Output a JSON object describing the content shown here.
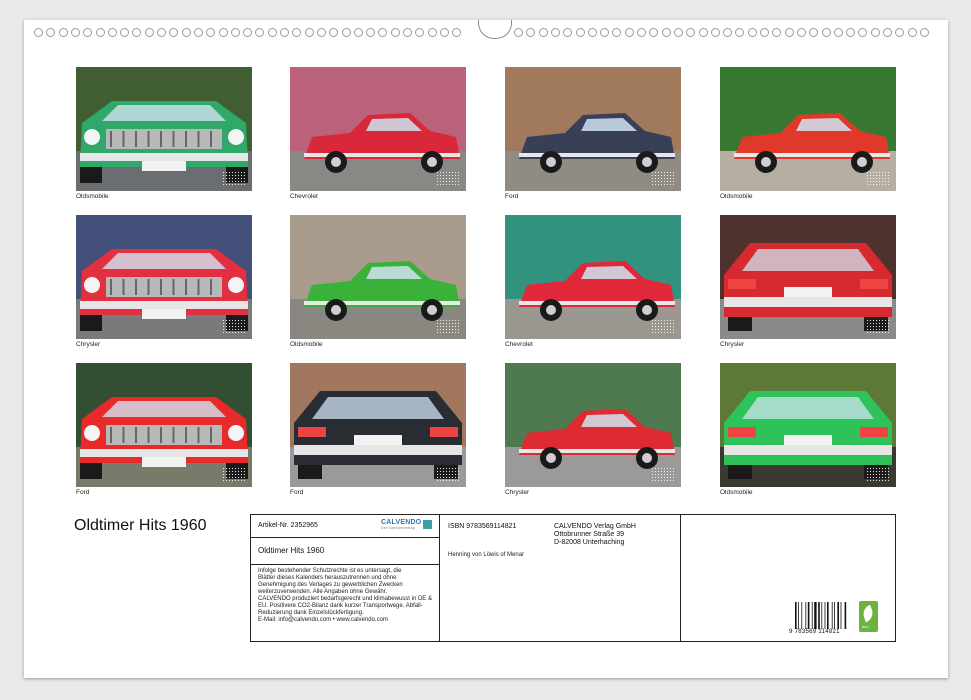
{
  "calendar": {
    "title": "Oldtimer Hits 1960",
    "photos": [
      {
        "caption": "Oldsmobile",
        "body": "#2fa86a",
        "bg": "#4a6a3a",
        "ground": "#6a6e70",
        "view": "front"
      },
      {
        "caption": "Chevrolet",
        "body": "#d8283a",
        "bg": "#d4708a",
        "ground": "#8a8884",
        "view": "side"
      },
      {
        "caption": "Ford",
        "body": "#3a3f58",
        "bg": "#b88a6a",
        "ground": "#908c84",
        "view": "side"
      },
      {
        "caption": "Oldsmobile",
        "body": "#e0382a",
        "bg": "#3f8a3a",
        "ground": "#b6aea2",
        "view": "side"
      },
      {
        "caption": "Chrysler",
        "body": "#e23040",
        "bg": "#4a5a8a",
        "ground": "#7a7a7a",
        "view": "front"
      },
      {
        "caption": "Oldsmobile",
        "body": "#3ab23a",
        "bg": "#c2b2a0",
        "ground": "#8a8680",
        "view": "side"
      },
      {
        "caption": "Chevrolet",
        "body": "#e0283a",
        "bg": "#38a890",
        "ground": "#9a9690",
        "view": "side"
      },
      {
        "caption": "Chrysler",
        "body": "#d62a30",
        "bg": "#5a3a34",
        "ground": "#8a8a8a",
        "view": "rear"
      },
      {
        "caption": "Ford",
        "body": "#e82a2a",
        "bg": "#3a5a3a",
        "ground": "#7a7a6a",
        "view": "front"
      },
      {
        "caption": "Ford",
        "body": "#2a2c34",
        "bg": "#b8886a",
        "ground": "#9a9a9a",
        "view": "rear"
      },
      {
        "caption": "Chrysler",
        "body": "#e02a32",
        "bg": "#5a8a5a",
        "ground": "#9a9a9a",
        "view": "side"
      },
      {
        "caption": "Oldsmobile",
        "body": "#2ec25a",
        "bg": "#6a8a40",
        "ground": "#3a3a30",
        "view": "rear"
      }
    ],
    "colors": {
      "border": "#222222",
      "accent": "#2a7ab8",
      "eco": "#6cb33e"
    }
  },
  "info": {
    "article": "Artikel-Nr. 2352965",
    "brand": "CALVENDO",
    "brand_sub": "Der Kalenderverlag",
    "title": "Oldtimer Hits 1960",
    "legal": [
      "Infolge bestehender Schutzrechte ist es untersagt, die",
      "Blätter dieses Kalenders herauszutrennen und ohne",
      "Genehmigung des Verlages zu gewerblichen Zwecken",
      "weiterzuverwenden. Alle Angaben ohne Gewähr.",
      "CALVENDO produziert bedarfsgerecht und klimabewusst in DE &",
      "EU. Positivere CO2-Bilanz dank kurzer Transportwege. Abfall-",
      "Reduzierung dank Einzelstückfertigung.",
      "E-Mail: info@calvendo.com • www.calvendo.com"
    ],
    "isbn": "ISBN 9783569114821",
    "publisher": [
      "CALVENDO Verlag GmbH",
      "Ottobrunner Straße 39",
      "D-82008 Unterhaching"
    ],
    "author": "Henning von Löwis of Menar",
    "barcode_number": "9 783569 114821",
    "eco_label": "eco"
  }
}
